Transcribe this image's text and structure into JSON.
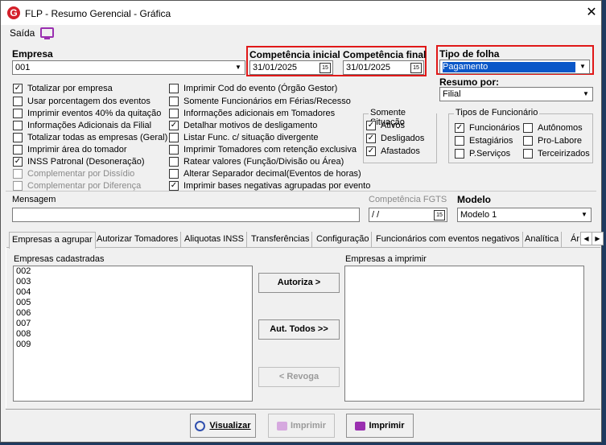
{
  "window": {
    "title": "FLP - Resumo Gerencial - Gráfica",
    "close_glyph": "✕",
    "app_icon_letter": "G"
  },
  "menu": {
    "saida": "Saída",
    "icon": "tv-icon"
  },
  "empresa": {
    "label": "Empresa",
    "value": "001"
  },
  "competencia_inicial": {
    "label": "Competência inicial",
    "value": "31/01/2025"
  },
  "competencia_final": {
    "label": "Competência final",
    "value": "31/01/2025"
  },
  "tipo_folha": {
    "label": "Tipo de folha",
    "value": "Pagamento"
  },
  "resumo_por": {
    "label": "Resumo por:",
    "value": "Filial"
  },
  "options_col1": [
    {
      "label": "Totalizar por empresa",
      "checked": true,
      "enabled": true
    },
    {
      "label": "Usar porcentagem dos eventos",
      "checked": false,
      "enabled": true
    },
    {
      "label": "Imprimir eventos 40% da quitação",
      "checked": false,
      "enabled": true
    },
    {
      "label": "Informações Adicionais da Filial",
      "checked": false,
      "enabled": true
    },
    {
      "label": "Totalizar todas as empresas (Geral)",
      "checked": false,
      "enabled": true
    },
    {
      "label": "Imprimir área do tomador",
      "checked": false,
      "enabled": true
    },
    {
      "label": "INSS Patronal (Desoneração)",
      "checked": true,
      "enabled": true
    },
    {
      "label": "Complementar por Dissídio",
      "checked": false,
      "enabled": false
    },
    {
      "label": "Complementar por Diferença",
      "checked": false,
      "enabled": false
    }
  ],
  "options_col2": [
    {
      "label": "Imprimir Cod do evento (Órgão Gestor)",
      "checked": false
    },
    {
      "label": "Somente Funcionários em Férias/Recesso",
      "checked": false
    },
    {
      "label": "Informações adicionais em Tomadores",
      "checked": false
    },
    {
      "label": "Detalhar motivos de desligamento",
      "checked": true
    },
    {
      "label": "Listar Func. c/ situação divergente",
      "checked": false
    },
    {
      "label": "Imprimir Tomadores com retenção exclusiva",
      "checked": false
    },
    {
      "label": "Ratear valores (Função/Divisão ou Área)",
      "checked": false
    },
    {
      "label": "Alterar Separador decimal(Eventos de horas)",
      "checked": false
    },
    {
      "label": "Imprimir bases negativas agrupadas por evento",
      "checked": true
    }
  ],
  "somente_situacao": {
    "title": "Somente Situação",
    "items": [
      {
        "label": "Ativos",
        "checked": true
      },
      {
        "label": "Desligados",
        "checked": true
      },
      {
        "label": "Afastados",
        "checked": true
      }
    ]
  },
  "tipos_funcionario": {
    "title": "Tipos de Funcionário",
    "items": [
      {
        "label": "Funcionários",
        "checked": true
      },
      {
        "label": "Autônomos",
        "checked": false
      },
      {
        "label": "Estagiários",
        "checked": false
      },
      {
        "label": "Pro-Labore",
        "checked": false
      },
      {
        "label": "P.Serviços",
        "checked": false
      },
      {
        "label": "Terceirizados",
        "checked": false
      }
    ]
  },
  "mensagem": {
    "label": "Mensagem",
    "value": ""
  },
  "competencia_fgts": {
    "label": "Competência FGTS",
    "value": " /  /"
  },
  "modelo": {
    "label": "Modelo",
    "value": "Modelo 1"
  },
  "tabs": [
    "Empresas a agrupar",
    "Autorizar Tomadores",
    "Aliquotas INSS",
    "Transferências",
    "Configuração",
    "Funcionários com eventos negativos",
    "Analítica",
    "Ár"
  ],
  "empresas_cadastradas": {
    "label": "Empresas cadastradas",
    "items": [
      "002",
      "003",
      "004",
      "005",
      "006",
      "007",
      "008",
      "009"
    ]
  },
  "empresas_imprimir": {
    "label": "Empresas a imprimir",
    "items": []
  },
  "buttons": {
    "autoriza": "Autoriza >",
    "aut_todos": "Aut. Todos >>",
    "revoga": "< Revoga",
    "visualizar": "Visualizar",
    "imprimir_disabled": "Imprimir",
    "imprimir": "Imprimir"
  },
  "glyphs": {
    "dropdown": "▼",
    "calendar": "15",
    "check": "✓",
    "tab_left": "◀",
    "tab_right": "▶"
  }
}
